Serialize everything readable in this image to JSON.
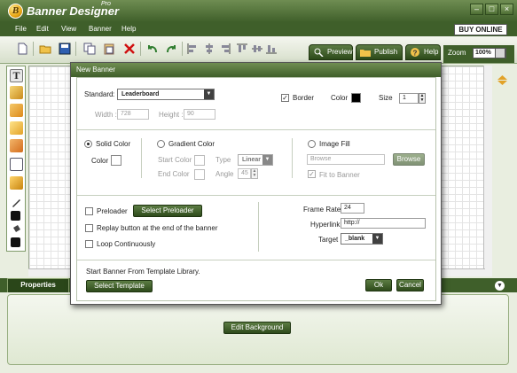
{
  "app": {
    "title": "Banner Designer",
    "edition": "Pro",
    "buy_label": "BUY ONLINE"
  },
  "menu": [
    "File",
    "Edit",
    "View",
    "Banner",
    "Help"
  ],
  "toolbar_tabs": {
    "preview": "Preview",
    "publish": "Publish",
    "help": "Help",
    "zoom_label": "Zoom",
    "zoom_value": "100%"
  },
  "properties": {
    "tab_label": "Properties",
    "edit_background": "Edit Background"
  },
  "dialog": {
    "title": "New Banner",
    "standard_label": "Standard",
    "standard_value": "Leaderboard",
    "width_label": "Width :",
    "width_value": "728",
    "height_label": "Height :",
    "height_value": "90",
    "border_label": "Border",
    "border_checked": true,
    "color_label": "Color",
    "size_label": "Size",
    "size_value": "1",
    "solid_color": "Solid Color",
    "solid_color_selected": true,
    "solid_color_label": "Color",
    "gradient_color": "Gradient Color",
    "start_color": "Start Color",
    "end_color": "End Color",
    "type_label": "Type",
    "type_value": "Linear",
    "angle_label": "Angle",
    "angle_value": "45",
    "image_fill": "Image Fill",
    "browse_placeholder": "Browse",
    "browse_button": "Browse",
    "fit_to_banner": "Fit to Banner",
    "fit_checked": true,
    "preloader": "Preloader",
    "select_preloader": "Select Preloader",
    "replay_button": "Replay button at the end of the banner",
    "loop_continuously": "Loop Continuously",
    "frame_rate_label": "Frame Rate :",
    "frame_rate_value": "24",
    "hyperlink_label": "Hyperlink :",
    "hyperlink_value": "http://",
    "target_label": "Target :",
    "target_value": "_blank",
    "template_text": "Start Banner From Template Library.",
    "select_template": "Select Template",
    "ok": "Ok",
    "cancel": "Cancel"
  },
  "colors": {
    "accent_green": "#3f5f2a",
    "button_green": "#4b6b34",
    "border_swatch": "#000000"
  }
}
